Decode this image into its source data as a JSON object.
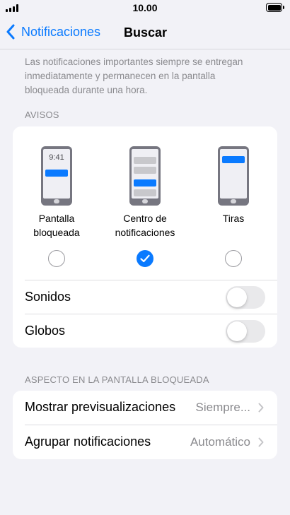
{
  "status_bar": {
    "time": "10.00"
  },
  "nav": {
    "back_label": "Notificaciones",
    "title": "Buscar"
  },
  "description": "Las notificaciones importantes siempre se entregan inmediatamente y permanecen en la pantalla bloqueada durante una hora.",
  "alerts": {
    "header": "AVISOS",
    "styles": [
      {
        "line1": "Pantalla",
        "line2": "bloqueada",
        "preview_time": "9:41",
        "selected": false
      },
      {
        "line1": "Centro de",
        "line2": "notificaciones",
        "selected": true
      },
      {
        "line1": "Tiras",
        "line2": "",
        "selected": false
      }
    ],
    "sounds_label": "Sonidos",
    "sounds_on": false,
    "badges_label": "Globos",
    "badges_on": false
  },
  "lock_screen": {
    "header": "ASPECTO EN LA PANTALLA BLOQUEADA",
    "show_previews_label": "Mostrar previsualizaciones",
    "show_previews_value": "Siempre...",
    "group_label": "Agrupar notificaciones",
    "group_value": "Automático"
  },
  "colors": {
    "accent": "#0a7aff",
    "background": "#f2f2f7",
    "secondary_text": "#8a8a8e"
  }
}
